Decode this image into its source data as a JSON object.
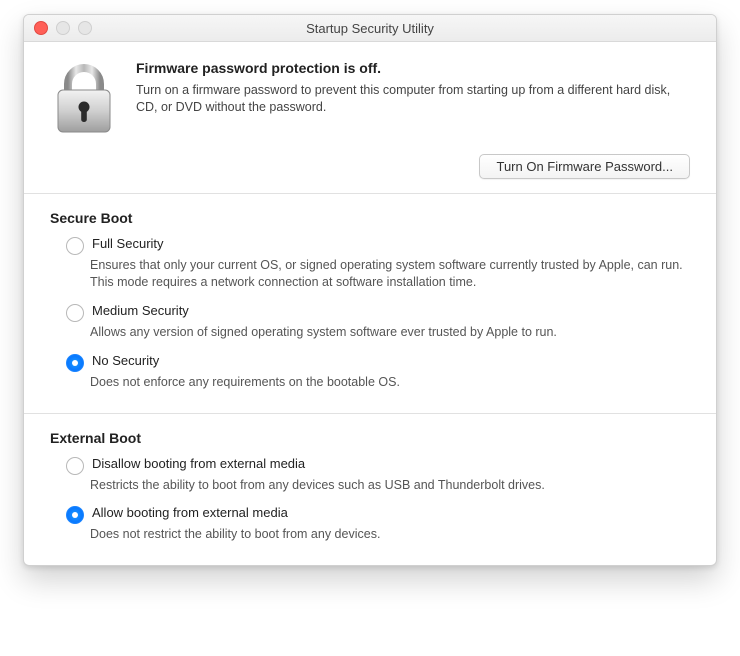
{
  "window": {
    "title": "Startup Security Utility"
  },
  "firmware": {
    "heading": "Firmware password protection is off.",
    "desc": "Turn on a firmware password to prevent this computer from starting up from a different hard disk, CD, or DVD without the password.",
    "button": "Turn On Firmware Password..."
  },
  "secure_boot": {
    "heading": "Secure Boot",
    "options": [
      {
        "label": "Full Security",
        "desc": "Ensures that only your current OS, or signed operating system software currently trusted by Apple, can run. This mode requires a network connection at software installation time.",
        "selected": false
      },
      {
        "label": "Medium Security",
        "desc": "Allows any version of signed operating system software ever trusted by Apple to run.",
        "selected": false
      },
      {
        "label": "No Security",
        "desc": "Does not enforce any requirements on the bootable OS.",
        "selected": true
      }
    ]
  },
  "external_boot": {
    "heading": "External Boot",
    "options": [
      {
        "label": "Disallow booting from external media",
        "desc": "Restricts the ability to boot from any devices such as USB and Thunderbolt drives.",
        "selected": false
      },
      {
        "label": "Allow booting from external media",
        "desc": "Does not restrict the ability to boot from any devices.",
        "selected": true
      }
    ]
  }
}
